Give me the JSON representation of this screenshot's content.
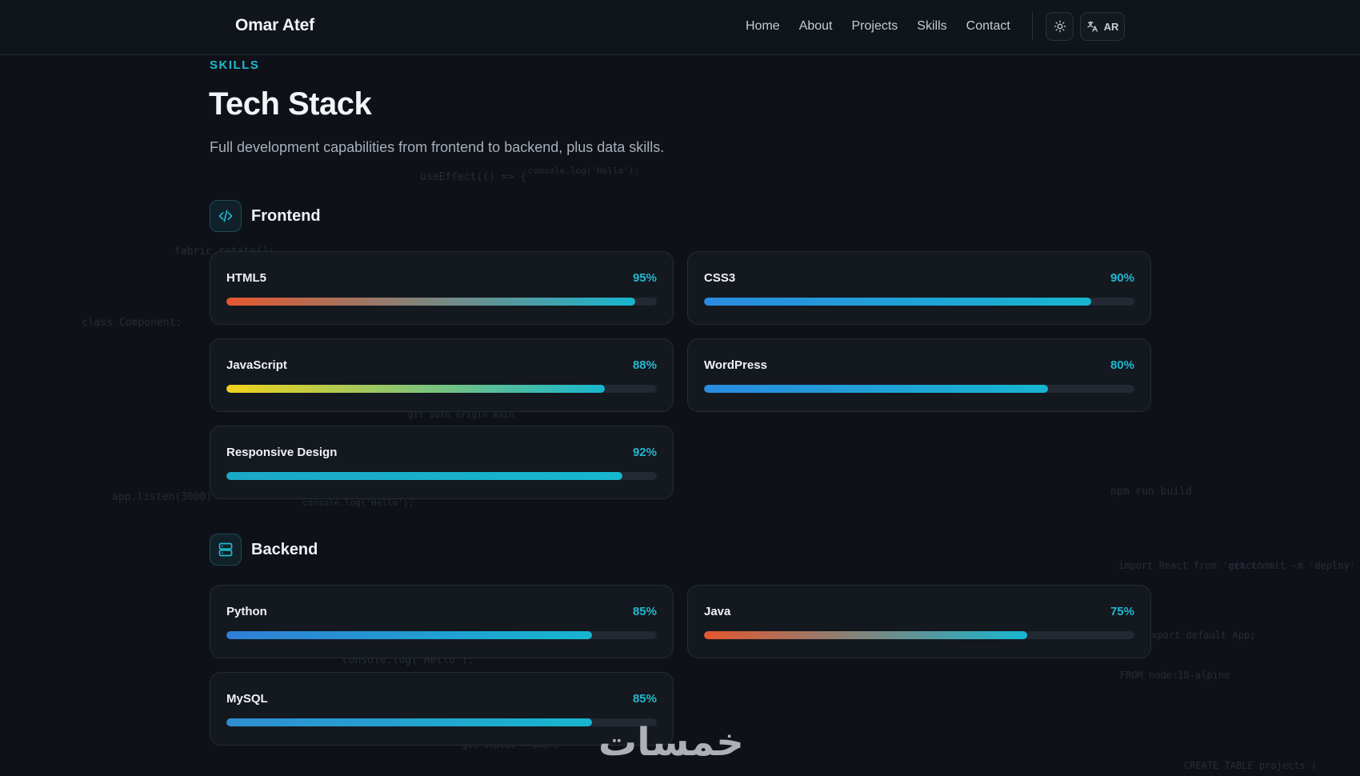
{
  "brand": "Omar Atef",
  "nav": [
    "Home",
    "About",
    "Projects",
    "Skills",
    "Contact"
  ],
  "lang_label": "AR",
  "section": {
    "tag": "SKILLS",
    "title": "Tech Stack",
    "subtitle": "Full development capabilities from frontend to backend, plus data skills."
  },
  "groups": [
    {
      "title": "Frontend",
      "icon": "code-icon",
      "skills": [
        {
          "name": "HTML5",
          "percent": 95,
          "label": "95%",
          "gradient": [
            "#e4572e",
            "#17b6cf"
          ]
        },
        {
          "name": "CSS3",
          "percent": 90,
          "label": "90%",
          "gradient": [
            "#2a8be0",
            "#17b6cf"
          ]
        },
        {
          "name": "JavaScript",
          "percent": 88,
          "label": "88%",
          "gradient": [
            "#f2d21b",
            "#17b6cf"
          ]
        },
        {
          "name": "WordPress",
          "percent": 80,
          "label": "80%",
          "gradient": [
            "#2a8be0",
            "#17b6cf"
          ]
        },
        {
          "name": "Responsive Design",
          "percent": 92,
          "label": "92%",
          "gradient": [
            "#1aa8c8",
            "#17b6cf"
          ]
        }
      ]
    },
    {
      "title": "Backend",
      "icon": "server-icon",
      "skills": [
        {
          "name": "Python",
          "percent": 85,
          "label": "85%",
          "gradient": [
            "#2f7fd6",
            "#17b6cf"
          ]
        },
        {
          "name": "Java",
          "percent": 75,
          "label": "75%",
          "gradient": [
            "#e4572e",
            "#17b6cf"
          ]
        },
        {
          "name": "MySQL",
          "percent": 85,
          "label": "85%",
          "gradient": [
            "#2f8fd0",
            "#17b6cf"
          ]
        }
      ]
    }
  ],
  "watermark": "خمسات"
}
